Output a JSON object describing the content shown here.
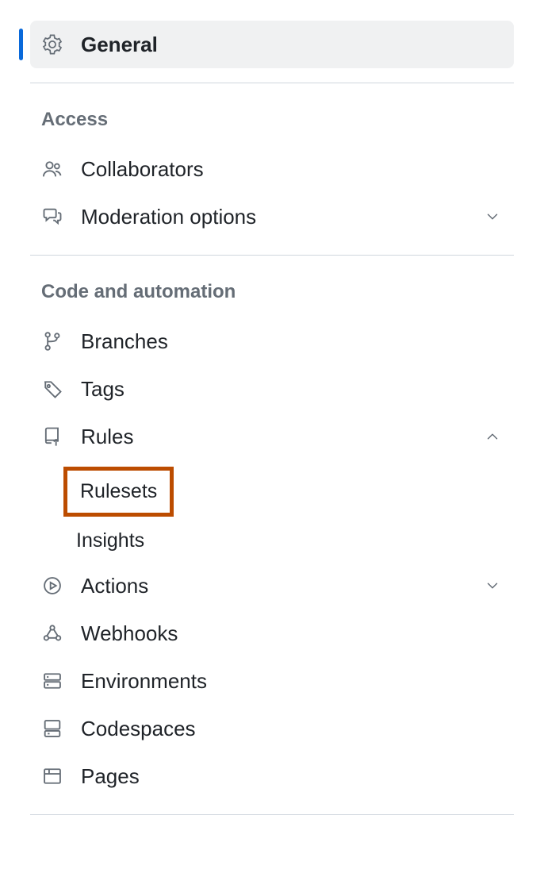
{
  "general": {
    "label": "General"
  },
  "sections": {
    "access": {
      "heading": "Access",
      "collaborators": "Collaborators",
      "moderation": "Moderation options"
    },
    "code_automation": {
      "heading": "Code and automation",
      "branches": "Branches",
      "tags": "Tags",
      "rules": "Rules",
      "rules_sub": {
        "rulesets": "Rulesets",
        "insights": "Insights"
      },
      "actions": "Actions",
      "webhooks": "Webhooks",
      "environments": "Environments",
      "codespaces": "Codespaces",
      "pages": "Pages"
    }
  }
}
